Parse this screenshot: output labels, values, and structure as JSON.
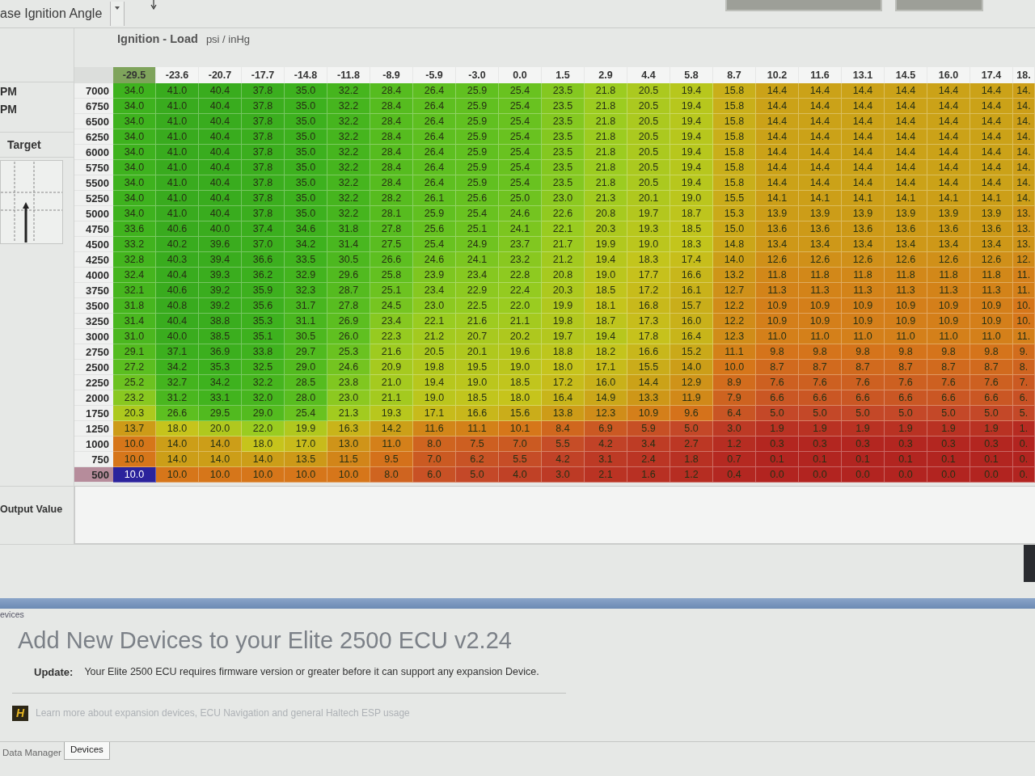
{
  "top_bar": {
    "tab_title": "ase Ignition Angle"
  },
  "side_panel": {
    "rows": [
      {
        "label": "PM"
      },
      {
        "label": "PM"
      }
    ],
    "target_label": "Target",
    "output_label": "Output Value"
  },
  "map": {
    "title": "Ignition - Load",
    "units": "psi / inHg",
    "columns": [
      {
        "label": "-29.5",
        "selected": true
      },
      {
        "label": "-23.6",
        "selected": false
      },
      {
        "label": "-20.7",
        "selected": false
      },
      {
        "label": "-17.7",
        "selected": false
      },
      {
        "label": "-14.8",
        "selected": false
      },
      {
        "label": "-11.8",
        "selected": false
      },
      {
        "label": "-8.9",
        "selected": false
      },
      {
        "label": "-5.9",
        "selected": false
      },
      {
        "label": "-3.0",
        "selected": false
      },
      {
        "label": "0.0",
        "selected": false
      },
      {
        "label": "1.5",
        "selected": false
      },
      {
        "label": "2.9",
        "selected": false
      },
      {
        "label": "4.4",
        "selected": false
      },
      {
        "label": "5.8",
        "selected": false
      },
      {
        "label": "8.7",
        "selected": false
      },
      {
        "label": "10.2",
        "selected": false
      },
      {
        "label": "11.6",
        "selected": false
      },
      {
        "label": "13.1",
        "selected": false
      },
      {
        "label": "14.5",
        "selected": false
      },
      {
        "label": "16.0",
        "selected": false
      },
      {
        "label": "17.4",
        "selected": false
      },
      {
        "label": "18.",
        "selected": false
      }
    ],
    "rows": [
      {
        "label": "7000",
        "selected": false,
        "cells": [
          "34.0",
          "41.0",
          "40.4",
          "37.8",
          "35.0",
          "32.2",
          "28.4",
          "26.4",
          "25.9",
          "25.4",
          "23.5",
          "21.8",
          "20.5",
          "19.4",
          "15.8",
          "14.4",
          "14.4",
          "14.4",
          "14.4",
          "14.4",
          "14.4",
          "14."
        ]
      },
      {
        "label": "6750",
        "selected": false,
        "cells": [
          "34.0",
          "41.0",
          "40.4",
          "37.8",
          "35.0",
          "32.2",
          "28.4",
          "26.4",
          "25.9",
          "25.4",
          "23.5",
          "21.8",
          "20.5",
          "19.4",
          "15.8",
          "14.4",
          "14.4",
          "14.4",
          "14.4",
          "14.4",
          "14.4",
          "14."
        ]
      },
      {
        "label": "6500",
        "selected": false,
        "cells": [
          "34.0",
          "41.0",
          "40.4",
          "37.8",
          "35.0",
          "32.2",
          "28.4",
          "26.4",
          "25.9",
          "25.4",
          "23.5",
          "21.8",
          "20.5",
          "19.4",
          "15.8",
          "14.4",
          "14.4",
          "14.4",
          "14.4",
          "14.4",
          "14.4",
          "14."
        ]
      },
      {
        "label": "6250",
        "selected": false,
        "cells": [
          "34.0",
          "41.0",
          "40.4",
          "37.8",
          "35.0",
          "32.2",
          "28.4",
          "26.4",
          "25.9",
          "25.4",
          "23.5",
          "21.8",
          "20.5",
          "19.4",
          "15.8",
          "14.4",
          "14.4",
          "14.4",
          "14.4",
          "14.4",
          "14.4",
          "14."
        ]
      },
      {
        "label": "6000",
        "selected": false,
        "cells": [
          "34.0",
          "41.0",
          "40.4",
          "37.8",
          "35.0",
          "32.2",
          "28.4",
          "26.4",
          "25.9",
          "25.4",
          "23.5",
          "21.8",
          "20.5",
          "19.4",
          "15.8",
          "14.4",
          "14.4",
          "14.4",
          "14.4",
          "14.4",
          "14.4",
          "14."
        ]
      },
      {
        "label": "5750",
        "selected": false,
        "cells": [
          "34.0",
          "41.0",
          "40.4",
          "37.8",
          "35.0",
          "32.2",
          "28.4",
          "26.4",
          "25.9",
          "25.4",
          "23.5",
          "21.8",
          "20.5",
          "19.4",
          "15.8",
          "14.4",
          "14.4",
          "14.4",
          "14.4",
          "14.4",
          "14.4",
          "14."
        ]
      },
      {
        "label": "5500",
        "selected": false,
        "cells": [
          "34.0",
          "41.0",
          "40.4",
          "37.8",
          "35.0",
          "32.2",
          "28.4",
          "26.4",
          "25.9",
          "25.4",
          "23.5",
          "21.8",
          "20.5",
          "19.4",
          "15.8",
          "14.4",
          "14.4",
          "14.4",
          "14.4",
          "14.4",
          "14.4",
          "14."
        ]
      },
      {
        "label": "5250",
        "selected": false,
        "cells": [
          "34.0",
          "41.0",
          "40.4",
          "37.8",
          "35.0",
          "32.2",
          "28.2",
          "26.1",
          "25.6",
          "25.0",
          "23.0",
          "21.3",
          "20.1",
          "19.0",
          "15.5",
          "14.1",
          "14.1",
          "14.1",
          "14.1",
          "14.1",
          "14.1",
          "14."
        ]
      },
      {
        "label": "5000",
        "selected": false,
        "cells": [
          "34.0",
          "41.0",
          "40.4",
          "37.8",
          "35.0",
          "32.2",
          "28.1",
          "25.9",
          "25.4",
          "24.6",
          "22.6",
          "20.8",
          "19.7",
          "18.7",
          "15.3",
          "13.9",
          "13.9",
          "13.9",
          "13.9",
          "13.9",
          "13.9",
          "13."
        ]
      },
      {
        "label": "4750",
        "selected": false,
        "cells": [
          "33.6",
          "40.6",
          "40.0",
          "37.4",
          "34.6",
          "31.8",
          "27.8",
          "25.6",
          "25.1",
          "24.1",
          "22.1",
          "20.3",
          "19.3",
          "18.5",
          "15.0",
          "13.6",
          "13.6",
          "13.6",
          "13.6",
          "13.6",
          "13.6",
          "13."
        ]
      },
      {
        "label": "4500",
        "selected": false,
        "cells": [
          "33.2",
          "40.2",
          "39.6",
          "37.0",
          "34.2",
          "31.4",
          "27.5",
          "25.4",
          "24.9",
          "23.7",
          "21.7",
          "19.9",
          "19.0",
          "18.3",
          "14.8",
          "13.4",
          "13.4",
          "13.4",
          "13.4",
          "13.4",
          "13.4",
          "13."
        ]
      },
      {
        "label": "4250",
        "selected": false,
        "cells": [
          "32.8",
          "40.3",
          "39.4",
          "36.6",
          "33.5",
          "30.5",
          "26.6",
          "24.6",
          "24.1",
          "23.2",
          "21.2",
          "19.4",
          "18.3",
          "17.4",
          "14.0",
          "12.6",
          "12.6",
          "12.6",
          "12.6",
          "12.6",
          "12.6",
          "12."
        ]
      },
      {
        "label": "4000",
        "selected": false,
        "cells": [
          "32.4",
          "40.4",
          "39.3",
          "36.2",
          "32.9",
          "29.6",
          "25.8",
          "23.9",
          "23.4",
          "22.8",
          "20.8",
          "19.0",
          "17.7",
          "16.6",
          "13.2",
          "11.8",
          "11.8",
          "11.8",
          "11.8",
          "11.8",
          "11.8",
          "11."
        ]
      },
      {
        "label": "3750",
        "selected": false,
        "cells": [
          "32.1",
          "40.6",
          "39.2",
          "35.9",
          "32.3",
          "28.7",
          "25.1",
          "23.4",
          "22.9",
          "22.4",
          "20.3",
          "18.5",
          "17.2",
          "16.1",
          "12.7",
          "11.3",
          "11.3",
          "11.3",
          "11.3",
          "11.3",
          "11.3",
          "11."
        ]
      },
      {
        "label": "3500",
        "selected": false,
        "cells": [
          "31.8",
          "40.8",
          "39.2",
          "35.6",
          "31.7",
          "27.8",
          "24.5",
          "23.0",
          "22.5",
          "22.0",
          "19.9",
          "18.1",
          "16.8",
          "15.7",
          "12.2",
          "10.9",
          "10.9",
          "10.9",
          "10.9",
          "10.9",
          "10.9",
          "10."
        ]
      },
      {
        "label": "3250",
        "selected": false,
        "cells": [
          "31.4",
          "40.4",
          "38.8",
          "35.3",
          "31.1",
          "26.9",
          "23.4",
          "22.1",
          "21.6",
          "21.1",
          "19.8",
          "18.7",
          "17.3",
          "16.0",
          "12.2",
          "10.9",
          "10.9",
          "10.9",
          "10.9",
          "10.9",
          "10.9",
          "10."
        ]
      },
      {
        "label": "3000",
        "selected": false,
        "cells": [
          "31.0",
          "40.0",
          "38.5",
          "35.1",
          "30.5",
          "26.0",
          "22.3",
          "21.2",
          "20.7",
          "20.2",
          "19.7",
          "19.4",
          "17.8",
          "16.4",
          "12.3",
          "11.0",
          "11.0",
          "11.0",
          "11.0",
          "11.0",
          "11.0",
          "11."
        ]
      },
      {
        "label": "2750",
        "selected": false,
        "cells": [
          "29.1",
          "37.1",
          "36.9",
          "33.8",
          "29.7",
          "25.3",
          "21.6",
          "20.5",
          "20.1",
          "19.6",
          "18.8",
          "18.2",
          "16.6",
          "15.2",
          "11.1",
          "9.8",
          "9.8",
          "9.8",
          "9.8",
          "9.8",
          "9.8",
          "9."
        ]
      },
      {
        "label": "2500",
        "selected": false,
        "cells": [
          "27.2",
          "34.2",
          "35.3",
          "32.5",
          "29.0",
          "24.6",
          "20.9",
          "19.8",
          "19.5",
          "19.0",
          "18.0",
          "17.1",
          "15.5",
          "14.0",
          "10.0",
          "8.7",
          "8.7",
          "8.7",
          "8.7",
          "8.7",
          "8.7",
          "8."
        ]
      },
      {
        "label": "2250",
        "selected": false,
        "cells": [
          "25.2",
          "32.7",
          "34.2",
          "32.2",
          "28.5",
          "23.8",
          "21.0",
          "19.4",
          "19.0",
          "18.5",
          "17.2",
          "16.0",
          "14.4",
          "12.9",
          "8.9",
          "7.6",
          "7.6",
          "7.6",
          "7.6",
          "7.6",
          "7.6",
          "7."
        ]
      },
      {
        "label": "2000",
        "selected": false,
        "cells": [
          "23.2",
          "31.2",
          "33.1",
          "32.0",
          "28.0",
          "23.0",
          "21.1",
          "19.0",
          "18.5",
          "18.0",
          "16.4",
          "14.9",
          "13.3",
          "11.9",
          "7.9",
          "6.6",
          "6.6",
          "6.6",
          "6.6",
          "6.6",
          "6.6",
          "6."
        ]
      },
      {
        "label": "1750",
        "selected": false,
        "cells": [
          "20.3",
          "26.6",
          "29.5",
          "29.0",
          "25.4",
          "21.3",
          "19.3",
          "17.1",
          "16.6",
          "15.6",
          "13.8",
          "12.3",
          "10.9",
          "9.6",
          "6.4",
          "5.0",
          "5.0",
          "5.0",
          "5.0",
          "5.0",
          "5.0",
          "5."
        ]
      },
      {
        "label": "1250",
        "selected": false,
        "cells": [
          "13.7",
          "18.0",
          "20.0",
          "22.0",
          "19.9",
          "16.3",
          "14.2",
          "11.6",
          "11.1",
          "10.1",
          "8.4",
          "6.9",
          "5.9",
          "5.0",
          "3.0",
          "1.9",
          "1.9",
          "1.9",
          "1.9",
          "1.9",
          "1.9",
          "1."
        ]
      },
      {
        "label": "1000",
        "selected": false,
        "cells": [
          "10.0",
          "14.0",
          "14.0",
          "18.0",
          "17.0",
          "13.0",
          "11.0",
          "8.0",
          "7.5",
          "7.0",
          "5.5",
          "4.2",
          "3.4",
          "2.7",
          "1.2",
          "0.3",
          "0.3",
          "0.3",
          "0.3",
          "0.3",
          "0.3",
          "0."
        ]
      },
      {
        "label": "750",
        "selected": false,
        "cells": [
          "10.0",
          "14.0",
          "14.0",
          "14.0",
          "13.5",
          "11.5",
          "9.5",
          "7.0",
          "6.2",
          "5.5",
          "4.2",
          "3.1",
          "2.4",
          "1.8",
          "0.7",
          "0.1",
          "0.1",
          "0.1",
          "0.1",
          "0.1",
          "0.1",
          "0."
        ]
      },
      {
        "label": "500",
        "selected": true,
        "cells": [
          "10.0",
          "10.0",
          "10.0",
          "10.0",
          "10.0",
          "10.0",
          "8.0",
          "6.0",
          "5.0",
          "4.0",
          "3.0",
          "2.1",
          "1.6",
          "1.2",
          "0.4",
          "0.0",
          "0.0",
          "0.0",
          "0.0",
          "0.0",
          "0.0",
          "0."
        ]
      }
    ]
  },
  "devices_panel": {
    "tab_label": "evices",
    "heading": "Add New Devices to your Elite 2500 ECU v2.24",
    "update_label": "Update:",
    "update_message": "Your Elite 2500 ECU requires firmware version or greater before it can support any expansion Device.",
    "logo_letter": "H",
    "link": "Learn more about expansion devices, ECU Navigation and general Haltech ESP usage"
  },
  "bottom_tabs": [
    {
      "label": "Data Manager",
      "selected": false
    },
    {
      "label": "Devices",
      "selected": true
    }
  ]
}
